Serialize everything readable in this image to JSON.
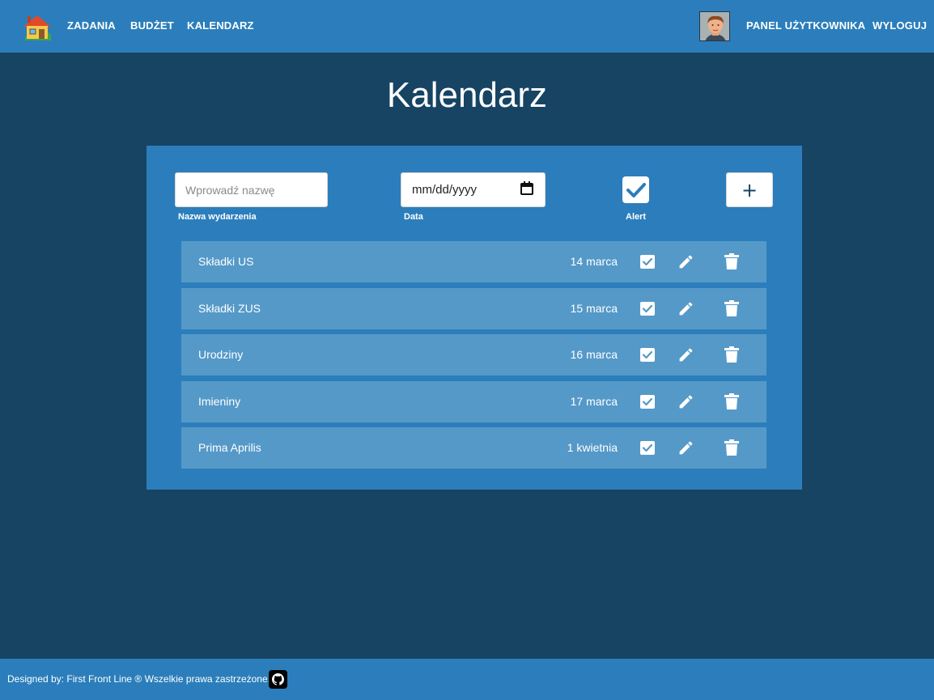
{
  "nav": {
    "logo_icon": "house-icon",
    "links": [
      "ZADANIA",
      "BUDŻET",
      "KALENDARZ"
    ],
    "user_panel": "PANEL UŻYTKOWNIKA",
    "logout": "WYLOGUJ"
  },
  "page": {
    "title": "Kalendarz"
  },
  "form": {
    "name_placeholder": "Wprowadź nazwę",
    "name_label": "Nazwa wydarzenia",
    "date_value": "mm/dd/yyyy",
    "date_label": "Data",
    "alert_label": "Alert",
    "alert_checked": true,
    "add_label": "+"
  },
  "events": [
    {
      "name": "Składki US",
      "date": "14 marca",
      "alert": true
    },
    {
      "name": "Składki ZUS",
      "date": "15 marca",
      "alert": true
    },
    {
      "name": "Urodziny",
      "date": "16 marca",
      "alert": true
    },
    {
      "name": "Imieniny",
      "date": "17 marca",
      "alert": true
    },
    {
      "name": "Prima Aprilis",
      "date": "1 kwietnia",
      "alert": true
    }
  ],
  "footer": {
    "text": "Designed by: First Front Line ® Wszelkie prawa zastrzeżone.",
    "github_icon": "github-icon"
  },
  "colors": {
    "background": "#174463",
    "primary": "#2b7ebb",
    "row": "#5599c8"
  }
}
